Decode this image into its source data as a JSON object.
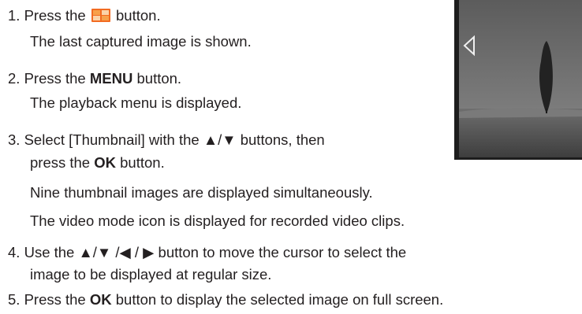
{
  "steps": [
    {
      "number": "1.",
      "text_before_icon": "Press the",
      "icon": "playback-icon",
      "text_after_icon": "button.",
      "detail": "The last captured image is shown."
    },
    {
      "number": "2.",
      "text_before_bold": "Press the",
      "bold": "MENU",
      "text_after_bold": "button.",
      "detail": "The playback menu is displayed."
    },
    {
      "number": "3.",
      "line1": "Select [Thumbnail] with the ▲/▼  buttons, then",
      "line2_before_bold": "press the",
      "bold": "OK",
      "line2_after_bold": "button.",
      "detail_lines": [
        "Nine thumbnail images are displayed simultaneously.",
        "The video mode icon is displayed for recorded video clips."
      ]
    },
    {
      "number": "4.",
      "line1": "Use the ▲/▼ /◀ / ▶ button to move the cursor to select the",
      "line2": "image to be displayed at regular size."
    },
    {
      "number": "5.",
      "text_before_bold": "Press the",
      "bold": "OK",
      "text_after_bold": "button to display the selected image on full screen."
    }
  ],
  "figure": {
    "type": "camera-lcd-photo",
    "arrow_icon": "left-arrow-icon",
    "colors": {
      "icon_orange": "#f26b21",
      "icon_light": "#f7a14a",
      "frame": "#1d1d1d"
    }
  }
}
